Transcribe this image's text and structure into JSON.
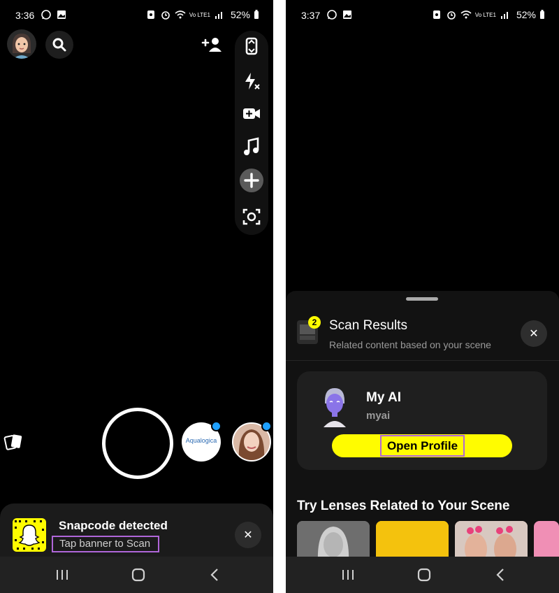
{
  "left_screen": {
    "status": {
      "time": "3:36",
      "network": "Vo LTE1",
      "battery": "52%"
    },
    "top_icons": [
      "bitmoji-avatar",
      "search-icon",
      "add-friend-icon"
    ],
    "side_rail": [
      "flip-camera-icon",
      "flash-off-icon",
      "video-chat-icon",
      "music-note-icon",
      "plus-icon",
      "scan-icon"
    ],
    "bottom": {
      "memories_icon": "cards-icon",
      "lens_brand": "Aqualogica"
    },
    "banner": {
      "title": "Snapcode detected",
      "subtitle": "Tap banner to Scan",
      "close": "✕"
    }
  },
  "right_screen": {
    "status": {
      "time": "3:37",
      "network": "Vo LTE1",
      "battery": "52%"
    },
    "scan_results": {
      "badge_count": "2",
      "title": "Scan Results",
      "subtitle": "Related content based on your scene",
      "close": "✕"
    },
    "profile_card": {
      "name": "My AI",
      "username": "myai",
      "button_label": "Open Profile"
    },
    "lenses_heading": "Try Lenses Related to Your Scene"
  },
  "nav": [
    "recent-apps-icon",
    "home-icon",
    "back-icon"
  ],
  "colors": {
    "snap_yellow": "#fffc00",
    "highlight_purple": "#b066d9",
    "notification_blue": "#1ea0ff"
  }
}
